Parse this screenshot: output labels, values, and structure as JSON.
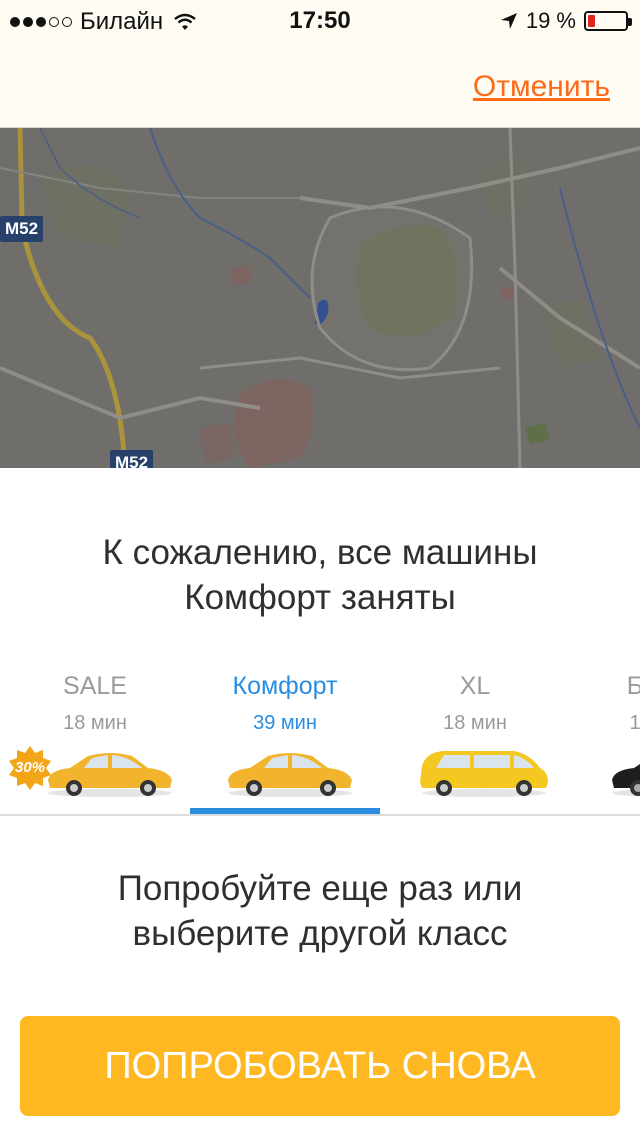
{
  "status_bar": {
    "carrier": "Билайн",
    "time": "17:50",
    "battery_percent": "19 %",
    "battery_level": 0.19,
    "signal_strength": 3
  },
  "nav": {
    "cancel_label": "Отменить"
  },
  "map": {
    "road_label_1": "M52",
    "road_label_2": "M52"
  },
  "message": {
    "line1": "К сожалению, все машины",
    "line2": "Комфорт заняты"
  },
  "classes": [
    {
      "name": "SALE",
      "time": "18 мин",
      "badge": "30%"
    },
    {
      "name": "Комфорт",
      "time": "39 мин"
    },
    {
      "name": "XL",
      "time": "18 мин"
    },
    {
      "name": "Б",
      "time": "1"
    }
  ],
  "hint": {
    "line1": "Попробуйте еще раз или",
    "line2": "выберите другой класс"
  },
  "retry_label": "ПОПРОБОВАТЬ СНОВА",
  "colors": {
    "accent_blue": "#2b8de0",
    "cancel_orange": "#ff6a1a",
    "button_yellow": "#ffb821"
  }
}
